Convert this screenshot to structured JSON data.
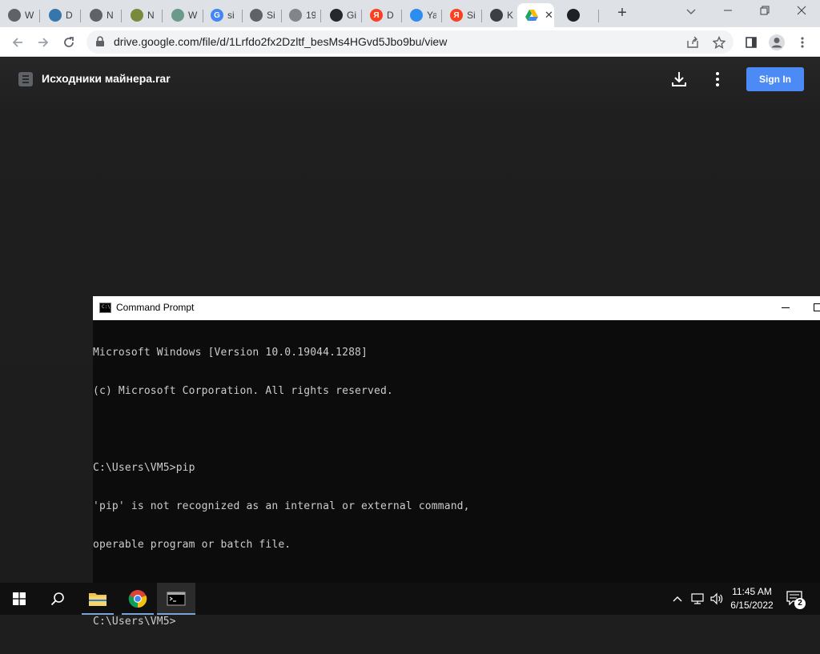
{
  "browser": {
    "tabs": [
      {
        "title": "W",
        "icon": "chrome-icon",
        "color": "#5f6368",
        "glyph": ""
      },
      {
        "title": "D",
        "icon": "python-icon",
        "color": "#3776ab",
        "glyph": ""
      },
      {
        "title": "N",
        "icon": "chrome-icon",
        "color": "#5f6368",
        "glyph": ""
      },
      {
        "title": "N",
        "icon": "arc-icon",
        "color": "#7a8a3c",
        "glyph": ""
      },
      {
        "title": "W",
        "icon": "doodle-icon",
        "color": "#6b9a8a",
        "glyph": ""
      },
      {
        "title": "si",
        "icon": "google-icon",
        "color": "#4285f4",
        "glyph": "G"
      },
      {
        "title": "Si",
        "icon": "globe-icon",
        "color": "#5f6368",
        "glyph": ""
      },
      {
        "title": "19",
        "icon": "globe-icon",
        "color": "#80868b",
        "glyph": ""
      },
      {
        "title": "Gi",
        "icon": "github-icon",
        "color": "#24292f",
        "glyph": ""
      },
      {
        "title": "D",
        "icon": "yandex-icon",
        "color": "#fc3f1d",
        "glyph": "Я"
      },
      {
        "title": "Ya",
        "icon": "yandex-browser-icon",
        "color": "#2d8cf0",
        "glyph": ""
      },
      {
        "title": "Si",
        "icon": "yandex-icon",
        "color": "#fc3f1d",
        "glyph": "Я"
      },
      {
        "title": "K",
        "icon": "coins-icon",
        "color": "#3c4043",
        "glyph": ""
      },
      {
        "title": "",
        "icon": "google-drive-icon",
        "color": "#1fa463",
        "glyph": "",
        "active": true
      },
      {
        "title": "",
        "icon": "qr-icon",
        "color": "#202124",
        "glyph": ""
      }
    ],
    "url": "drive.google.com/file/d/1Lrfdo2fx2Dzltf_besMs4HGvd5Jbo9bu/view"
  },
  "drive": {
    "file_name": "Исходники майнера.rar",
    "sign_in_label": "Sign In"
  },
  "cmd": {
    "title": "Command Prompt",
    "lines": [
      "Microsoft Windows [Version 10.0.19044.1288]",
      "(c) Microsoft Corporation. All rights reserved.",
      "",
      "C:\\Users\\VM5>pip",
      "'pip' is not recognized as an internal or external command,",
      "operable program or batch file.",
      "",
      "C:\\Users\\VM5>"
    ]
  },
  "taskbar": {
    "time": "11:45 AM",
    "date": "6/15/2022",
    "notification_count": "2"
  }
}
